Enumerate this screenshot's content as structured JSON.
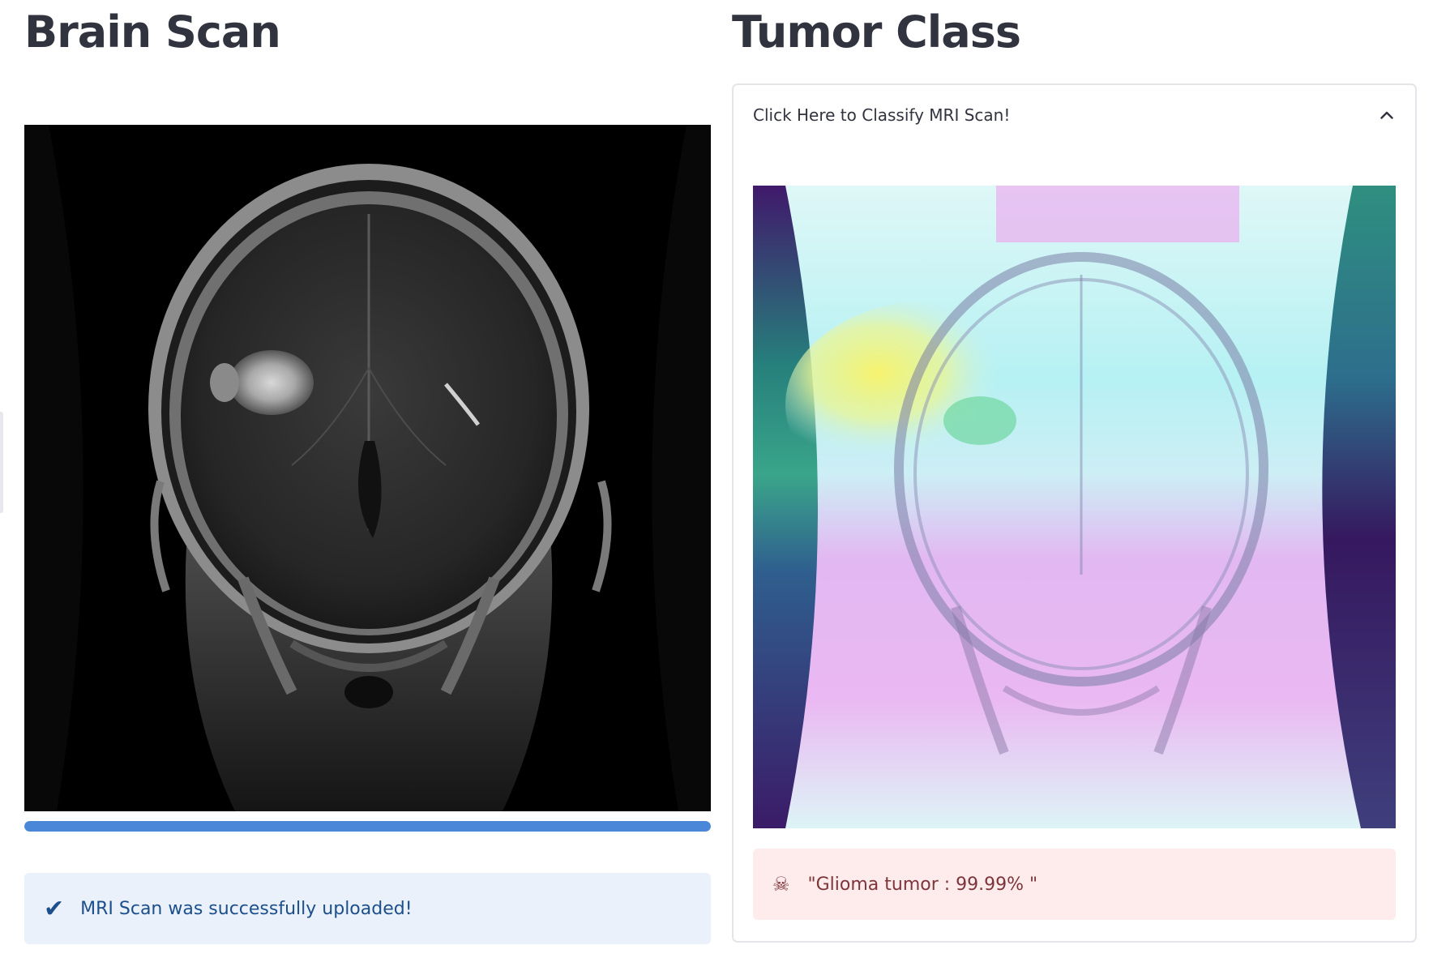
{
  "left": {
    "title": "Brain Scan",
    "upload_progress_percent": 100,
    "success_icon": "✔",
    "success_message": "MRI Scan was successfully uploaded!"
  },
  "right": {
    "title": "Tumor Class",
    "expander_label": "Click Here to Classify MRI Scan!",
    "expander_expanded": true,
    "result_icon": "☠",
    "result_message": "\"Glioma tumor : 99.99% \""
  },
  "colors": {
    "progress": "#4a87d8",
    "success_bg": "#eaf1fb",
    "success_text": "#1c4f8c",
    "error_bg": "#fdeceb",
    "error_text": "#7d353b"
  }
}
